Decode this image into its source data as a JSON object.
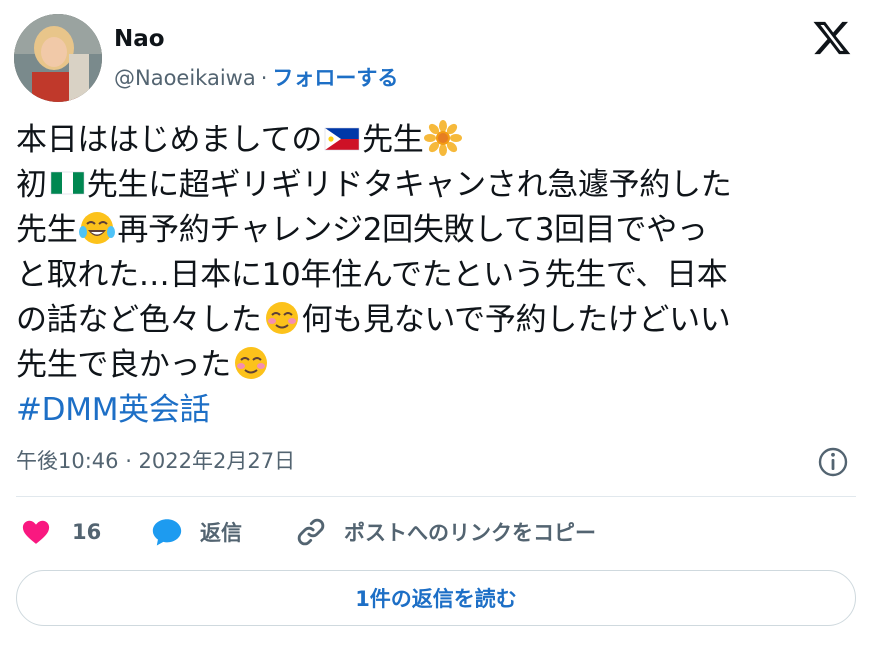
{
  "author": {
    "name": "Nao",
    "handle": "@Naoeikaiwa",
    "separator": "·",
    "follow_label": "フォローする"
  },
  "tweet": {
    "lines": [
      [
        "本日ははじめましての",
        "{philippines-flag-emoji}",
        "先生",
        "{sunflower-emoji}"
      ],
      [
        "初",
        "{nigeria-flag-emoji}",
        "先生に超ギリギリドタキャンされ急遽予約した"
      ],
      [
        "先生",
        "{tears-of-joy-emoji}",
        "再予約チャレンジ2回失敗して3回目でやっ"
      ],
      [
        "と取れた…日本に10年住んでたという先生で、日本"
      ],
      [
        "の話など色々した",
        "{smiling-blush-emoji}",
        "何も見ないで予約したけどいい"
      ],
      [
        "先生で良かった",
        "{smiling-blush-emoji}"
      ]
    ],
    "line1_a": "本日ははじめましての",
    "line1_b": "先生",
    "line2_a": "初",
    "line2_b": "先生に超ギリギリドタキャンされ急遽予約した",
    "line3_a": "先生",
    "line3_b": "再予約チャレンジ2回失敗して3回目でやっ",
    "line4": "と取れた…日本に10年住んでたという先生で、日本",
    "line5_a": "の話など色々した",
    "line5_b": "何も見ないで予約したけどいい",
    "line6": "先生で良かった",
    "hashtag": "#DMM英会話"
  },
  "timestamp": "午後10:46 · 2022年2月27日",
  "actions": {
    "like_count": "16",
    "reply_label": "返信",
    "copy_link_label": "ポストへのリンクをコピー"
  },
  "read_replies_label": "1件の返信を読む",
  "icons": {
    "logo": "x-logo-icon",
    "info": "info-icon",
    "like": "heart-icon",
    "reply": "speech-bubble-icon",
    "link": "link-icon"
  },
  "colors": {
    "link_blue": "#1d6fc6",
    "heart_pink": "#f91880",
    "reply_blue": "#1d9bf0",
    "muted_text": "#536471"
  }
}
